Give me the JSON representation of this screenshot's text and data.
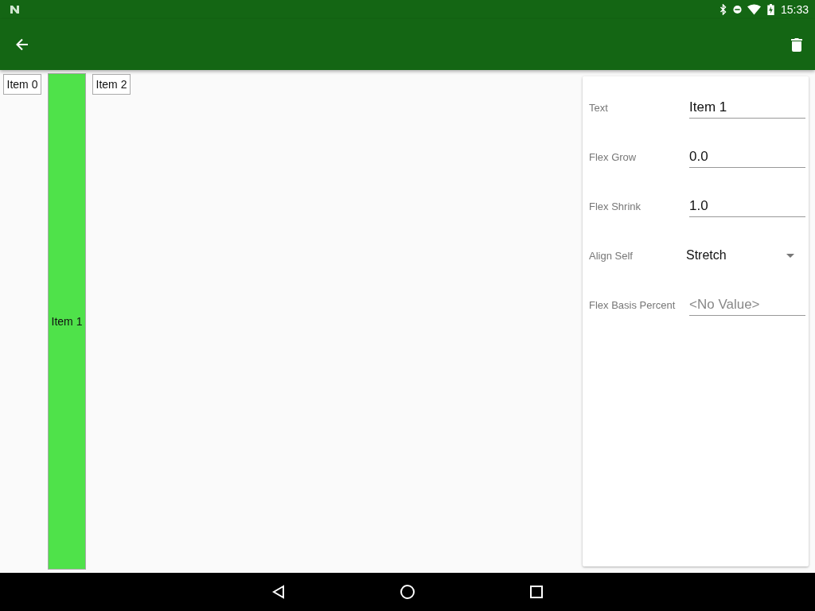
{
  "status_bar": {
    "time": "15:33"
  },
  "flex_items": [
    {
      "label": "Item 0",
      "selected": false
    },
    {
      "label": "Item 1",
      "selected": true
    },
    {
      "label": "Item 2",
      "selected": false
    }
  ],
  "properties": [
    {
      "kind": "text",
      "label": "Text",
      "value": "Item 1"
    },
    {
      "kind": "text",
      "label": "Flex Grow",
      "value": "0.0"
    },
    {
      "kind": "text",
      "label": "Flex Shrink",
      "value": "1.0"
    },
    {
      "kind": "dropdown",
      "label": "Align Self",
      "value": "Stretch"
    },
    {
      "kind": "text",
      "label": "Flex Basis Percent",
      "placeholder": "<No Value>"
    }
  ]
}
